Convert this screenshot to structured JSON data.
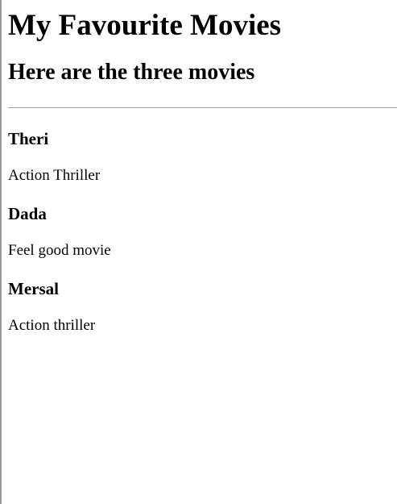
{
  "page": {
    "title": "My Favourite Movies",
    "subtitle": "Here are the three movies"
  },
  "movies": [
    {
      "title": "Theri",
      "genre": "Action Thriller"
    },
    {
      "title": "Dada",
      "genre": "Feel good movie"
    },
    {
      "title": "Mersal",
      "genre": "Action thriller"
    }
  ]
}
